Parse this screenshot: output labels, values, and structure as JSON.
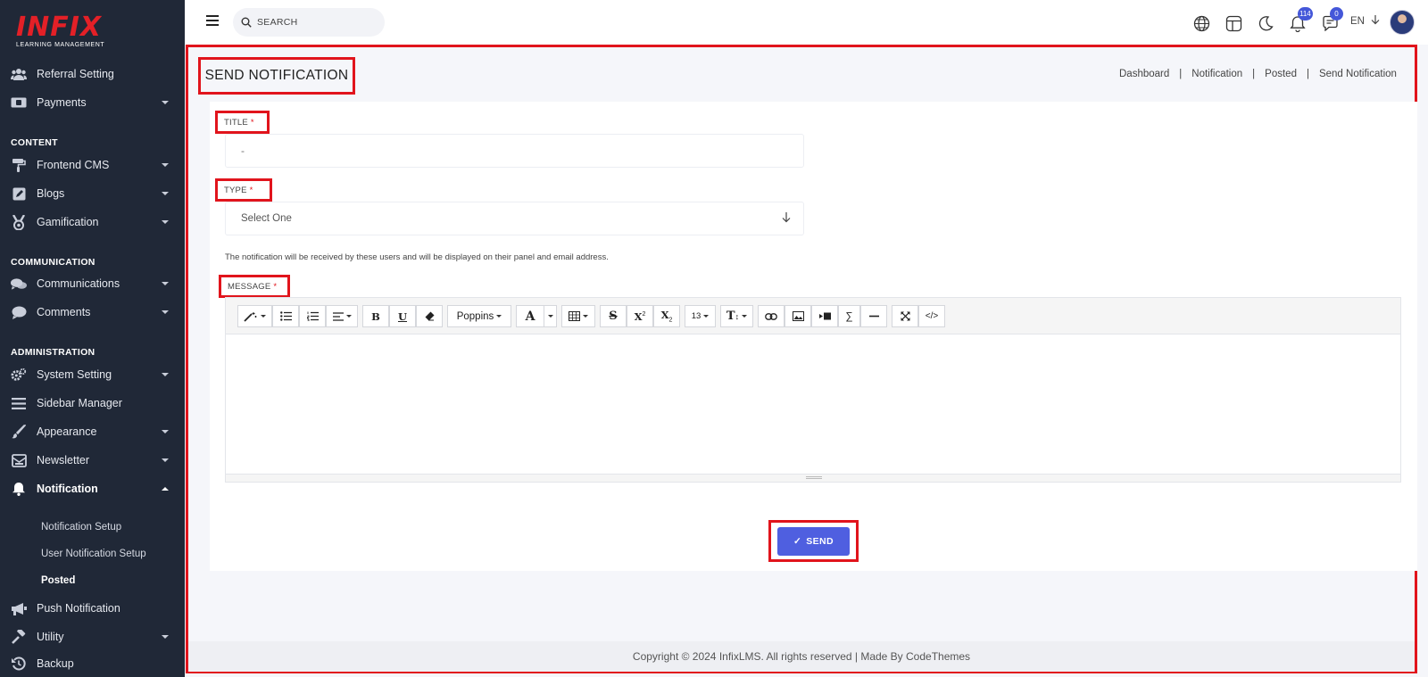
{
  "sidebar": {
    "logo": {
      "brand": "INFIX",
      "tagline": "LEARNING MANAGEMENT"
    },
    "items": [
      {
        "label": "Referral Setting",
        "icon": "users-icon"
      },
      {
        "label": "Payments",
        "icon": "money-icon"
      },
      {
        "label": "Frontend CMS",
        "icon": "paint-roller-icon"
      },
      {
        "label": "Blogs",
        "icon": "edit-icon"
      },
      {
        "label": "Gamification",
        "icon": "medal-icon"
      },
      {
        "label": "Communications",
        "icon": "chat-icon"
      },
      {
        "label": "Comments",
        "icon": "comment-icon"
      },
      {
        "label": "System Setting",
        "icon": "gears-icon"
      },
      {
        "label": "Sidebar Manager",
        "icon": "bars-icon"
      },
      {
        "label": "Appearance",
        "icon": "brush-icon"
      },
      {
        "label": "Newsletter",
        "icon": "newsletter-icon"
      },
      {
        "label": "Notification",
        "icon": "bell-icon"
      },
      {
        "label": "Push Notification",
        "icon": "megaphone-icon"
      },
      {
        "label": "Utility",
        "icon": "hammer-icon"
      },
      {
        "label": "Backup",
        "icon": "backup-icon"
      }
    ],
    "sections": {
      "content": "CONTENT",
      "communication": "COMMUNICATION",
      "administration": "ADMINISTRATION"
    },
    "notification_sub": [
      "Notification Setup",
      "User Notification Setup",
      "Posted"
    ]
  },
  "header": {
    "search_placeholder": "SEARCH",
    "language": "EN",
    "notification_count": "114",
    "message_count": "0"
  },
  "page": {
    "title": "SEND NOTIFICATION",
    "breadcrumb": [
      "Dashboard",
      "Notification",
      "Posted",
      "Send Notification"
    ]
  },
  "form": {
    "title_label": "TITLE",
    "title_placeholder": "-",
    "type_label": "TYPE",
    "type_value": "Select One",
    "hint": "The notification will be received by these users and will be displayed on their panel and email address.",
    "message_label": "MESSAGE",
    "required_mark": "*",
    "font_name": "Poppins",
    "font_size": "13",
    "send_label": "SEND"
  },
  "footer": {
    "text": "Copyright © 2024 InfixLMS. All rights reserved | Made By CodeThemes"
  },
  "colors": {
    "accent": "#4f5fe0",
    "sidebar": "#202837",
    "highlight": "#e1141c",
    "brand": "#e32027"
  }
}
